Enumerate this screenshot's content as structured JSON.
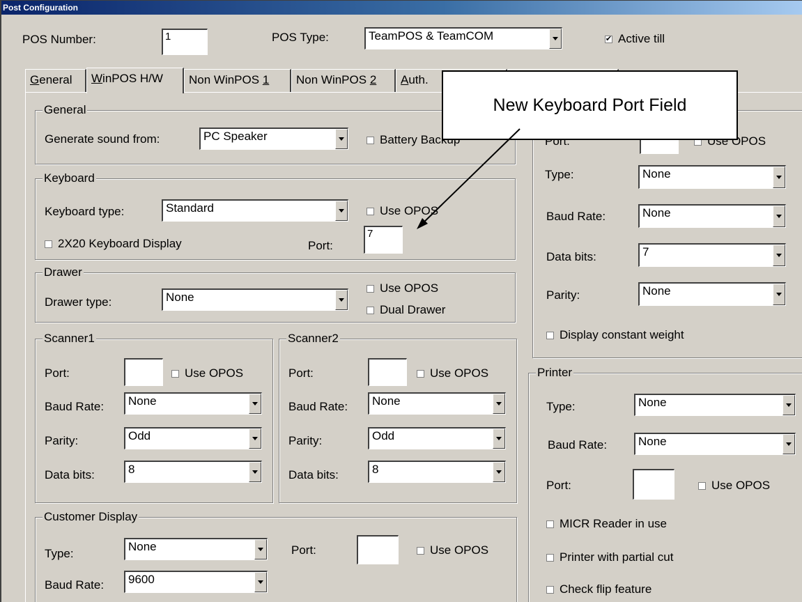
{
  "window": {
    "title": "Post Configuration"
  },
  "header": {
    "pos_number_label": "POS Number:",
    "pos_number_value": "1",
    "pos_type_label": "POS Type:",
    "pos_type_value": "TeamPOS & TeamCOM",
    "active_till_label": "Active till",
    "active_till_checked": true
  },
  "tabs": [
    {
      "pre": "",
      "u": "G",
      "post": "eneral"
    },
    {
      "pre": "",
      "u": "W",
      "post": "inPOS H/W"
    },
    {
      "pre": "Non WinPOS ",
      "u": "1",
      "post": ""
    },
    {
      "pre": "Non WinPOS ",
      "u": "2",
      "post": ""
    },
    {
      "pre": "",
      "u": "A",
      "post": "uth."
    }
  ],
  "callout": {
    "text": "New Keyboard Port Field"
  },
  "general": {
    "legend": "General",
    "sound_label": "Generate sound from:",
    "sound_value": "PC Speaker",
    "battery_label": "Battery Backup"
  },
  "keyboard": {
    "legend": "Keyboard",
    "type_label": "Keyboard type:",
    "type_value": "Standard",
    "use_opos_label": "Use OPOS",
    "display_label": "2X20 Keyboard Display",
    "port_label": "Port:",
    "port_value": "7"
  },
  "drawer": {
    "legend": "Drawer",
    "type_label": "Drawer type:",
    "type_value": "None",
    "use_opos_label": "Use OPOS",
    "dual_label": "Dual Drawer"
  },
  "scanner1": {
    "legend": "Scanner1",
    "port_label": "Port:",
    "port_value": "",
    "use_opos_label": "Use OPOS",
    "baud_label": "Baud Rate:",
    "baud_value": "None",
    "parity_label": "Parity:",
    "parity_value": "Odd",
    "bits_label": "Data bits:",
    "bits_value": "8"
  },
  "scanner2": {
    "legend": "Scanner2",
    "port_label": "Port:",
    "port_value": "",
    "use_opos_label": "Use OPOS",
    "baud_label": "Baud Rate:",
    "baud_value": "None",
    "parity_label": "Parity:",
    "parity_value": "Odd",
    "bits_label": "Data bits:",
    "bits_value": "8"
  },
  "customer_display": {
    "legend": "Customer Display",
    "type_label": "Type:",
    "type_value": "None",
    "port_label": "Port:",
    "port_value": "",
    "use_opos_label": "Use OPOS",
    "baud_label": "Baud Rate:",
    "baud_value": "9600"
  },
  "scale": {
    "port_label": "Port:",
    "port_value": "",
    "use_opos_label": "Use OPOS",
    "type_label": "Type:",
    "type_value": "None",
    "baud_label": "Baud Rate:",
    "baud_value": "None",
    "bits_label": "Data bits:",
    "bits_value": "7",
    "parity_label": "Parity:",
    "parity_value": "None",
    "constant_weight_label": "Display constant weight"
  },
  "printer": {
    "legend": "Printer",
    "type_label": "Type:",
    "type_value": "None",
    "baud_label": "Baud Rate:",
    "baud_value": "None",
    "port_label": "Port:",
    "port_value": "",
    "use_opos_label": "Use OPOS",
    "micr_label": "MICR Reader in use",
    "partial_cut_label": "Printer with partial cut",
    "check_flip_label": "Check flip feature"
  }
}
